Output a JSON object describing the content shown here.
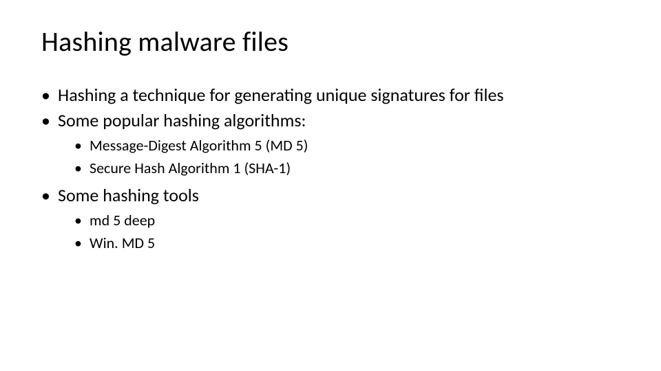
{
  "title": "Hashing malware files",
  "bullets": [
    {
      "text": "Hashing a technique for generating unique signatures for files"
    },
    {
      "text": "Some popular hashing algorithms:",
      "sub": [
        "Message-Digest Algorithm 5 (MD 5)",
        "Secure Hash Algorithm 1 (SHA-1)"
      ]
    },
    {
      "text": "Some hashing tools",
      "sub": [
        "md 5 deep",
        "Win. MD 5"
      ]
    }
  ]
}
